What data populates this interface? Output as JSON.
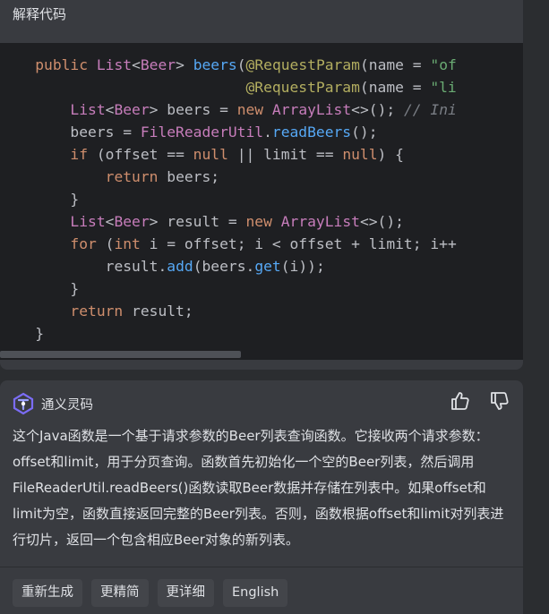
{
  "header": {
    "title": "解释代码"
  },
  "code": {
    "lines": [
      {
        "indent": "    ",
        "tokens": [
          {
            "c": "kw",
            "t": "public "
          },
          {
            "c": "ty",
            "t": "List"
          },
          {
            "c": "pl",
            "t": "<"
          },
          {
            "c": "ty",
            "t": "Beer"
          },
          {
            "c": "pl",
            "t": "> "
          },
          {
            "c": "fn",
            "t": "beers"
          },
          {
            "c": "pl",
            "t": "("
          },
          {
            "c": "ann",
            "t": "@RequestParam"
          },
          {
            "c": "pl",
            "t": "(name = "
          },
          {
            "c": "str",
            "t": "\"of"
          }
        ]
      },
      {
        "indent": "                            ",
        "tokens": [
          {
            "c": "ann",
            "t": "@RequestParam"
          },
          {
            "c": "pl",
            "t": "(name = "
          },
          {
            "c": "str",
            "t": "\"li"
          }
        ]
      },
      {
        "indent": "        ",
        "tokens": [
          {
            "c": "ty",
            "t": "List"
          },
          {
            "c": "pl",
            "t": "<"
          },
          {
            "c": "ty",
            "t": "Beer"
          },
          {
            "c": "pl",
            "t": "> beers = "
          },
          {
            "c": "kw",
            "t": "new "
          },
          {
            "c": "ty",
            "t": "ArrayList"
          },
          {
            "c": "pl",
            "t": "<>(); "
          },
          {
            "c": "cm",
            "t": "// Ini"
          }
        ]
      },
      {
        "indent": "        ",
        "tokens": [
          {
            "c": "pl",
            "t": "beers = "
          },
          {
            "c": "ty",
            "t": "FileReaderUtil"
          },
          {
            "c": "pl",
            "t": "."
          },
          {
            "c": "fn",
            "t": "readBeers"
          },
          {
            "c": "pl",
            "t": "();"
          }
        ]
      },
      {
        "indent": "        ",
        "tokens": [
          {
            "c": "kw",
            "t": "if "
          },
          {
            "c": "pl",
            "t": "(offset == "
          },
          {
            "c": "kw",
            "t": "null "
          },
          {
            "c": "pl",
            "t": "|| limit == "
          },
          {
            "c": "kw",
            "t": "null"
          },
          {
            "c": "pl",
            "t": ") {"
          }
        ]
      },
      {
        "indent": "            ",
        "tokens": [
          {
            "c": "kw",
            "t": "return "
          },
          {
            "c": "pl",
            "t": "beers;"
          }
        ]
      },
      {
        "indent": "        ",
        "tokens": [
          {
            "c": "pl",
            "t": "}"
          }
        ]
      },
      {
        "indent": "        ",
        "tokens": [
          {
            "c": "ty",
            "t": "List"
          },
          {
            "c": "pl",
            "t": "<"
          },
          {
            "c": "ty",
            "t": "Beer"
          },
          {
            "c": "pl",
            "t": "> result = "
          },
          {
            "c": "kw",
            "t": "new "
          },
          {
            "c": "ty",
            "t": "ArrayList"
          },
          {
            "c": "pl",
            "t": "<>();"
          }
        ]
      },
      {
        "indent": "        ",
        "tokens": [
          {
            "c": "kw",
            "t": "for "
          },
          {
            "c": "pl",
            "t": "("
          },
          {
            "c": "kw",
            "t": "int "
          },
          {
            "c": "pl",
            "t": "i = offset; i < offset + limit; i++"
          }
        ]
      },
      {
        "indent": "            ",
        "tokens": [
          {
            "c": "pl",
            "t": "result."
          },
          {
            "c": "fn",
            "t": "add"
          },
          {
            "c": "pl",
            "t": "(beers."
          },
          {
            "c": "fn",
            "t": "get"
          },
          {
            "c": "pl",
            "t": "(i));"
          }
        ]
      },
      {
        "indent": "        ",
        "tokens": [
          {
            "c": "pl",
            "t": "}"
          }
        ]
      },
      {
        "indent": "        ",
        "tokens": [
          {
            "c": "kw",
            "t": "return "
          },
          {
            "c": "pl",
            "t": "result;"
          }
        ]
      },
      {
        "indent": "    ",
        "tokens": [
          {
            "c": "pl",
            "t": "}"
          }
        ]
      }
    ]
  },
  "answer": {
    "brand_name": "通义灵码",
    "brand_icon": "tongyi-logo-icon",
    "like_icon": "thumbs-up-icon",
    "dislike_icon": "thumbs-down-icon",
    "text": "这个Java函数是一个基于请求参数的Beer列表查询函数。它接收两个请求参数：offset和limit，用于分页查询。函数首先初始化一个空的Beer列表，然后调用FileReaderUtil.readBeers()函数读取Beer数据并存储在列表中。如果offset和limit为空，函数直接返回完整的Beer列表。否则，函数根据offset和limit对列表进行切片，返回一个包含相应Beer对象的新列表。",
    "buttons": [
      "重新生成",
      "更精简",
      "更详细",
      "English"
    ]
  },
  "colors": {
    "keyword": "#cf8e6d",
    "type": "#c77dbb",
    "function": "#56a8f5",
    "annotation": "#b3ae60",
    "string": "#6aab73",
    "comment": "#7a7e85",
    "code_bg": "#1e1f22",
    "panel_bg": "#393b40",
    "button_bg": "#43454a"
  }
}
